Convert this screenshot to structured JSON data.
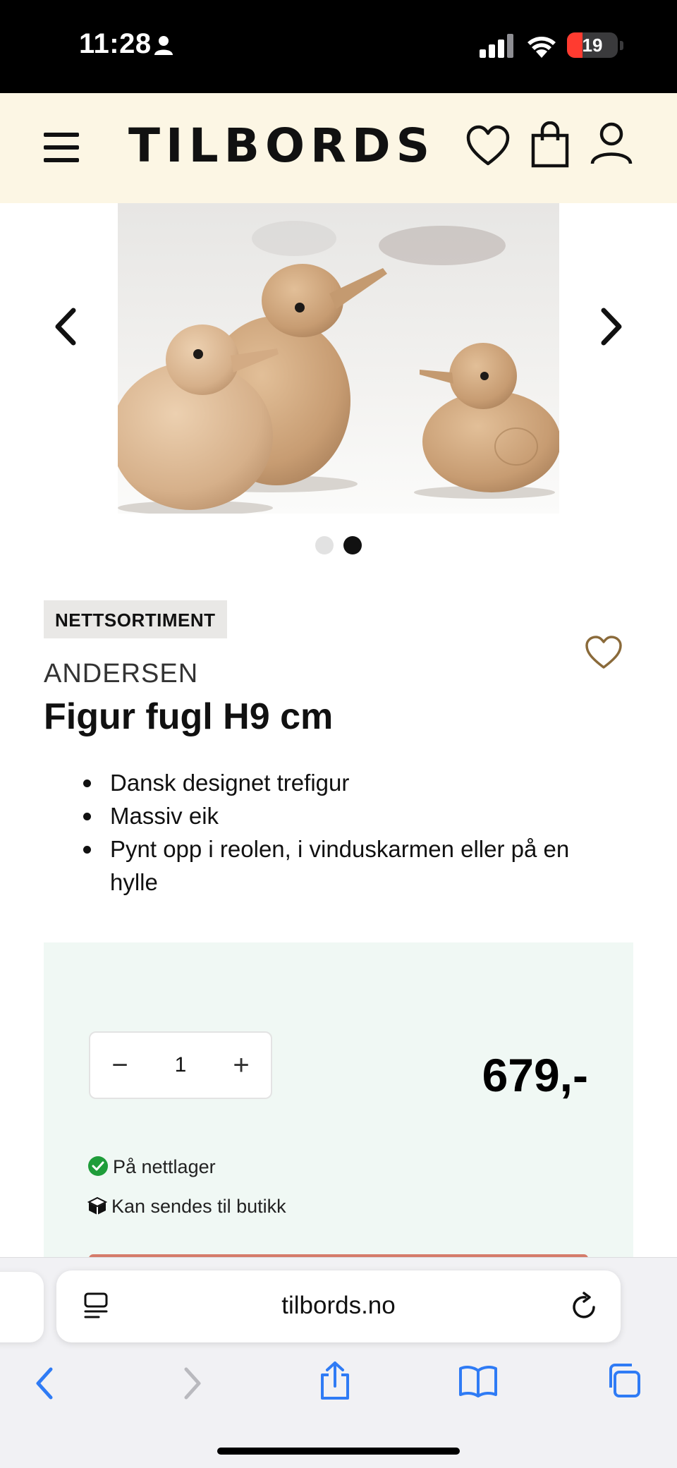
{
  "status_bar": {
    "time": "11:28",
    "battery_level": "19"
  },
  "header": {
    "logo": "TILBORDS",
    "icons": [
      "menu-icon",
      "heart-icon",
      "shopping-bag-icon",
      "user-icon"
    ]
  },
  "gallery": {
    "image_alt": "Wooden bird figures",
    "slide_count": 2,
    "active_slide": 2
  },
  "product": {
    "badge": "NETTSORTIMENT",
    "brand": "ANDERSEN",
    "title": "Figur fugl H9 cm",
    "features": [
      "Dansk designet trefigur",
      "Massiv eik",
      "Pynt opp i reolen, i vinduskarmen eller på en hylle"
    ]
  },
  "buy": {
    "quantity": "1",
    "minus_label": "−",
    "plus_label": "+",
    "price": "679,-",
    "stock_online": "På nettlager",
    "ship_to_store": "Kan sendes til butikk",
    "colors": {
      "panel": "#f0f8f4",
      "in_stock": "#1f9d3a"
    }
  },
  "browser": {
    "url": "tilbords.no"
  }
}
